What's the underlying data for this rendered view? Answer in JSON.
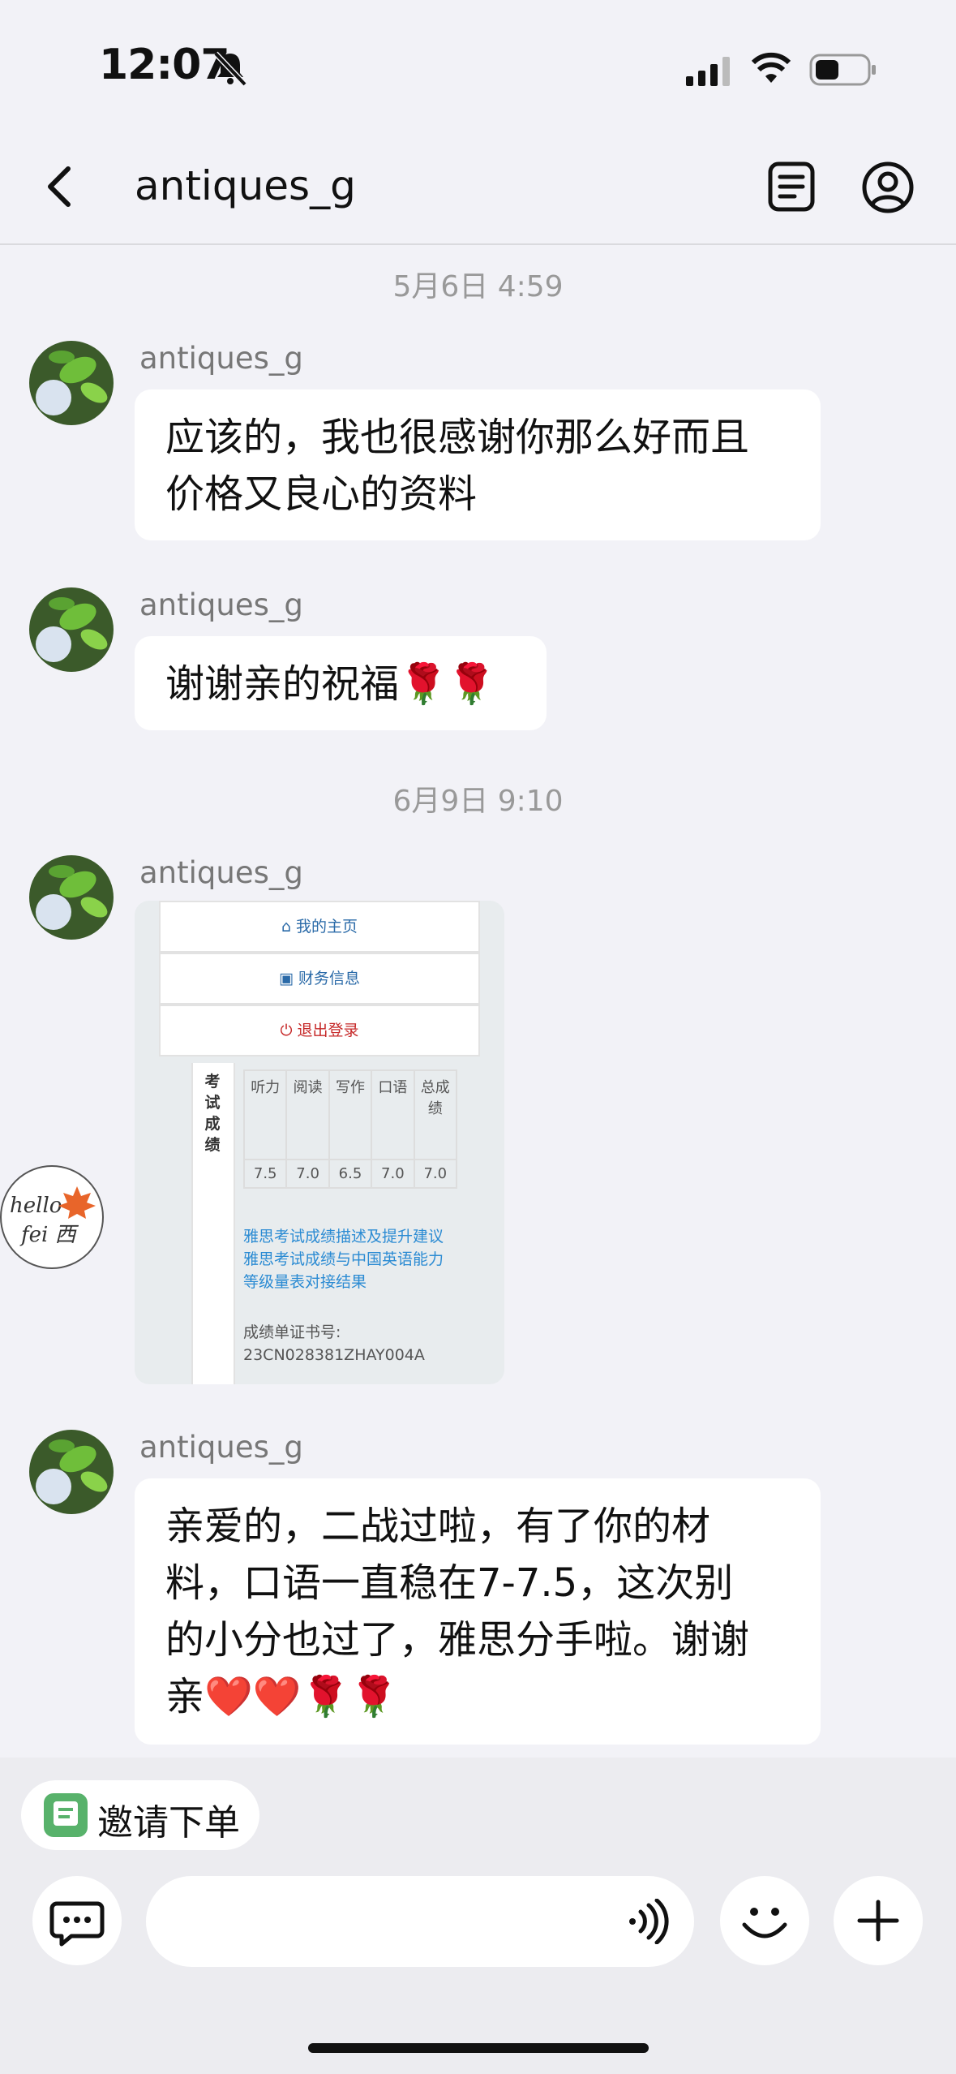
{
  "status_bar": {
    "time": "12:07"
  },
  "header": {
    "title": "antiques_g"
  },
  "messages": [
    {
      "timestamp": "5月6日 4:59"
    },
    {
      "sender": "antiques_g",
      "text_line1": "应该的，我也很感谢你那么好而且",
      "text_line2": "价格又良心的资料"
    },
    {
      "sender": "antiques_g",
      "text": "谢谢亲的祝福🌹🌹"
    },
    {
      "timestamp": "6月9日 9:10"
    },
    {
      "sender": "antiques_g"
    },
    {
      "sender": "antiques_g",
      "text_line1": "亲爱的，二战过啦，有了你的材",
      "text_line2": "料，口语一直稳在7-7.5，这次别",
      "text_line3": "的小分也过了，雅思分手啦。谢谢",
      "text_line4": "亲❤️❤️🌹🌹"
    }
  ],
  "score_image": {
    "menu": [
      "我的主页",
      "财务信息",
      "退出登录"
    ],
    "side_label": "考试成绩",
    "headers": [
      "听力",
      "阅读",
      "写作",
      "口语",
      "总成绩"
    ],
    "scores": [
      "7.5",
      "7.0",
      "6.5",
      "7.0",
      "7.0"
    ],
    "link1": "雅思考试成绩描述及提升建议",
    "link2_line1": "雅思考试成绩与中国英语能力",
    "link2_line2": "等级量表对接结果",
    "cert_label": "成绩单证书号:",
    "cert_no": "23CN028381ZHAY004A"
  },
  "badge": {
    "line1": "hello",
    "line2": "fei 西"
  },
  "invite": {
    "label": "邀请下单"
  },
  "colors": {
    "background": "#f2f2f7",
    "bubble": "#ffffff",
    "link": "#2b8bd3",
    "logout": "#c62828",
    "invite_icon": "#58b26b"
  }
}
